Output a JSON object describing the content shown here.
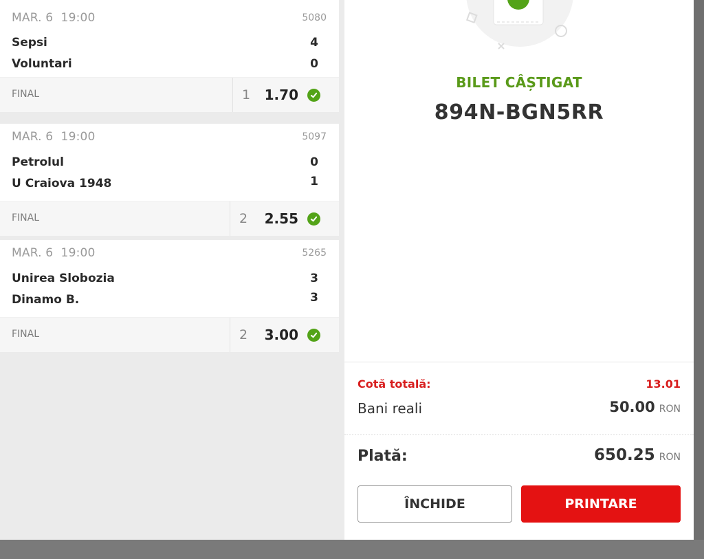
{
  "matches": [
    {
      "date": "MAR. 6",
      "time": "19:00",
      "code": "5080",
      "home": "Sepsi",
      "home_score": "4",
      "away": "Voluntari",
      "away_score": "0",
      "status": "FINAL",
      "pick": "1",
      "odd": "1.70"
    },
    {
      "date": "MAR. 6",
      "time": "19:00",
      "code": "5097",
      "home": "Petrolul",
      "home_score": "0",
      "away": "U Craiova 1948",
      "away_score": "1",
      "status": "FINAL",
      "pick": "2",
      "odd": "2.55"
    },
    {
      "date": "MAR. 6",
      "time": "19:00",
      "code": "5265",
      "home": "Unirea Slobozia",
      "home_score": "3",
      "away": "Dinamo B.",
      "away_score": "3",
      "status": "FINAL",
      "pick": "2",
      "odd": "3.00"
    }
  ],
  "ticket": {
    "status": "BILET CÂȘTIGAT",
    "id": "894N-BGN5RR"
  },
  "summary": {
    "cota_label": "Cotă totală:",
    "cota_value": "13.01",
    "bani_label": "Bani reali",
    "bani_value": "50.00",
    "plata_label": "Plată:",
    "plata_value": "650.25",
    "currency": "RON"
  },
  "buttons": {
    "close": "ÎNCHIDE",
    "print": "PRINTARE"
  },
  "colors": {
    "success": "#53a318",
    "accent": "#e41212"
  },
  "icons": [
    "ticket-illustration-icon",
    "check-circle-icon"
  ]
}
